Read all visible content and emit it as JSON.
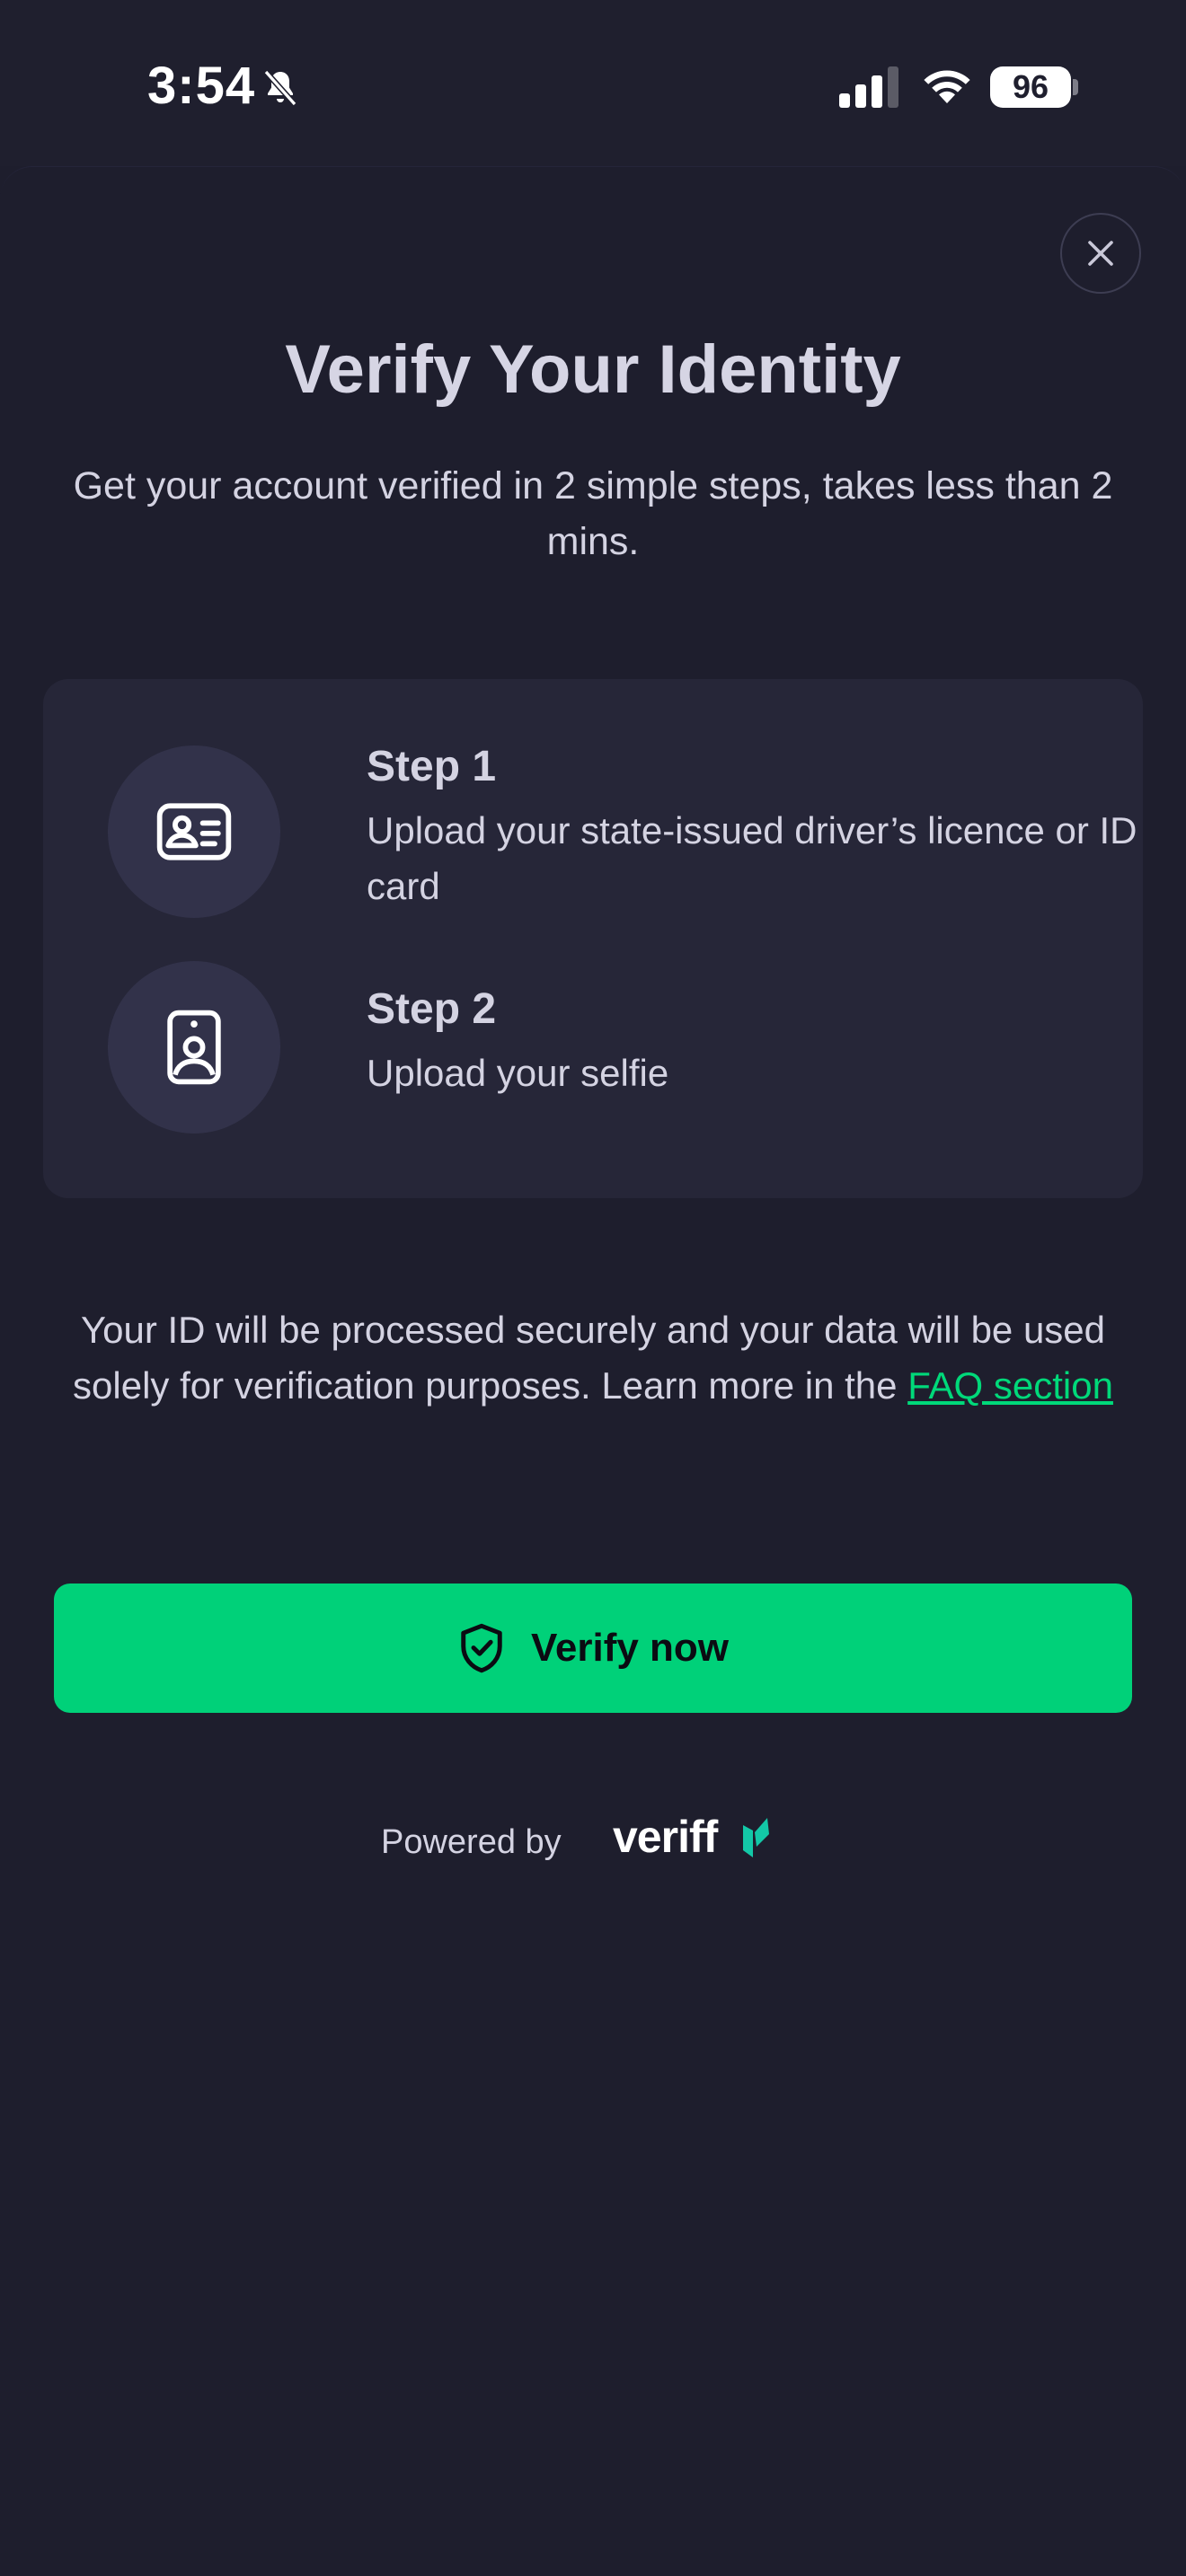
{
  "status_bar": {
    "time": "3:54",
    "battery": "96"
  },
  "sheet": {
    "title": "Verify Your Identity",
    "subtitle": "Get your account verified in 2 simple steps, takes less than 2 mins.",
    "steps": [
      {
        "title": "Step 1",
        "description": "Upload your state-issued driver’s licence or ID card",
        "icon": "id-card-icon"
      },
      {
        "title": "Step 2",
        "description": "Upload your selfie",
        "icon": "selfie-badge-icon"
      }
    ],
    "privacy_text": "Your ID will be processed securely and your data will be used solely for verification purposes. Learn more in the ",
    "faq_link": "FAQ section",
    "verify_button": "Verify now",
    "powered_by": "Powered by",
    "brand_logo": "veriff"
  },
  "colors": {
    "background": "#1e1e2d",
    "card": "#262638",
    "accent": "#00d179",
    "text": "#d4d3e2"
  }
}
